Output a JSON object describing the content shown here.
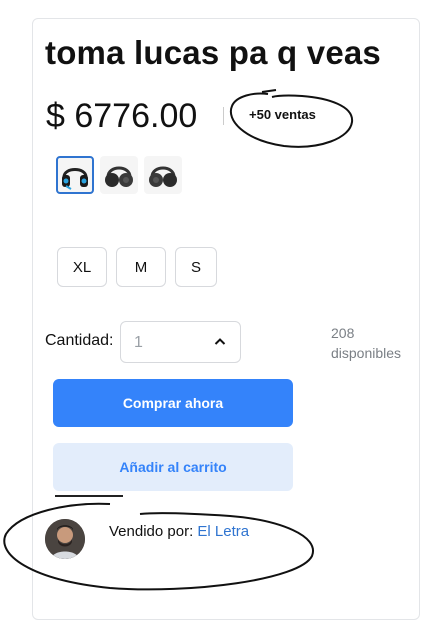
{
  "product": {
    "title": "toma lucas pa q veas",
    "price": "$ 6776.00",
    "sales_badge": "+50 ventas"
  },
  "gallery": {
    "thumbnails": [
      {
        "icon": "headset-blue-icon",
        "selected": true
      },
      {
        "icon": "headphones-black-icon",
        "selected": false
      },
      {
        "icon": "headphones-black-icon",
        "selected": false
      }
    ]
  },
  "sizes": [
    "XL",
    "M",
    "S"
  ],
  "quantity": {
    "label": "Cantidad:",
    "value": "1",
    "icon": "chevron-up-icon",
    "stock_count": "208",
    "stock_label": "disponibles"
  },
  "actions": {
    "buy_label": "Comprar ahora",
    "cart_label": "Añadir al carrito"
  },
  "seller": {
    "prefix": "Vendido por:",
    "name": "El Letra"
  },
  "colors": {
    "primary": "#3483fa",
    "primary_light": "#e3edfb",
    "link": "#2f74d0"
  }
}
